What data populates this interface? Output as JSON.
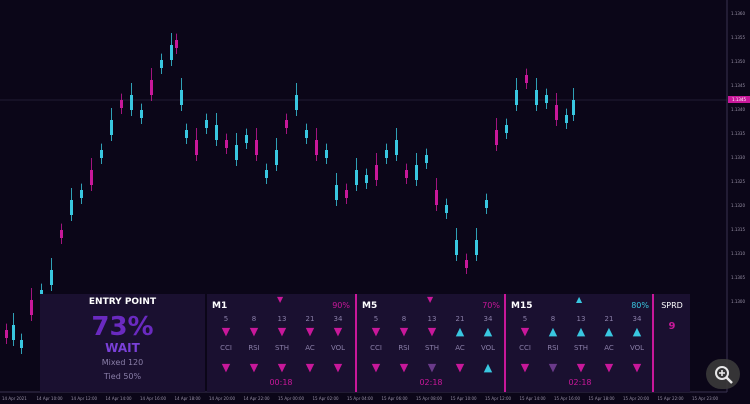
{
  "chart": {
    "symbol": "",
    "price_tag": "1.1345",
    "y_ticks": [
      "1.1360",
      "1.1355",
      "1.1350",
      "1.1345",
      "1.1340",
      "1.1335",
      "1.1330",
      "1.1325",
      "1.1320",
      "1.1315",
      "1.1310",
      "1.1305",
      "1.1300"
    ],
    "x_ticks": [
      "14 Apr 2021",
      "14 Apr 10:00",
      "14 Apr 12:00",
      "14 Apr 14:00",
      "14 Apr 16:00",
      "14 Apr 18:00",
      "14 Apr 20:00",
      "14 Apr 22:00",
      "15 Apr 00:00",
      "15 Apr 02:00",
      "15 Apr 04:00",
      "15 Apr 06:00",
      "15 Apr 08:00",
      "15 Apr 10:00",
      "15 Apr 12:00",
      "15 Apr 14:00",
      "15 Apr 16:00",
      "15 Apr 18:00",
      "15 Apr 20:00",
      "15 Apr 22:00",
      "15 Apr 23:00"
    ],
    "colors": {
      "bull": "#39c7e0",
      "bear": "#c8189a",
      "bg": "#0b0618",
      "panel": "#1a1030"
    }
  },
  "entry_point": {
    "title": "ENTRY POINT",
    "percent": "73%",
    "status": "WAIT",
    "mixed": "Mixed 120",
    "tied": "Tied 50%"
  },
  "timeframes": [
    {
      "name": "M1",
      "percent": "90%",
      "top_arrow": "▼",
      "top_dir": "dn",
      "periods": [
        "5",
        "8",
        "13",
        "21",
        "34"
      ],
      "row1": [
        {
          "g": "▼",
          "d": "dn"
        },
        {
          "g": "▼",
          "d": "dn"
        },
        {
          "g": "▼",
          "d": "dn"
        },
        {
          "g": "▼",
          "d": "dn"
        },
        {
          "g": "▼",
          "d": "dn"
        }
      ],
      "indicators": [
        "CCI",
        "RSI",
        "STH",
        "AC",
        "VOL"
      ],
      "row2": [
        {
          "g": "▼",
          "d": "dn"
        },
        {
          "g": "▼",
          "d": "dn"
        },
        {
          "g": "▼",
          "d": "dn"
        },
        {
          "g": "▼",
          "d": "dn"
        },
        {
          "g": "▼",
          "d": "dn"
        }
      ],
      "timer": "00:18"
    },
    {
      "name": "M5",
      "percent": "70%",
      "top_arrow": "▼",
      "top_dir": "dn",
      "periods": [
        "5",
        "8",
        "13",
        "21",
        "34"
      ],
      "row1": [
        {
          "g": "▼",
          "d": "dn"
        },
        {
          "g": "▼",
          "d": "dn"
        },
        {
          "g": "▼",
          "d": "dn"
        },
        {
          "g": "▲",
          "d": "up"
        },
        {
          "g": "▲",
          "d": "up"
        }
      ],
      "indicators": [
        "CCI",
        "RSI",
        "STH",
        "AC",
        "VOL"
      ],
      "row2": [
        {
          "g": "▼",
          "d": "dn"
        },
        {
          "g": "▼",
          "d": "dn"
        },
        {
          "g": "▼",
          "d": "ne"
        },
        {
          "g": "▼",
          "d": "dn"
        },
        {
          "g": "▲",
          "d": "up"
        }
      ],
      "timer": "02:18"
    },
    {
      "name": "M15",
      "percent": "80%",
      "top_arrow": "▲",
      "top_dir": "up",
      "periods": [
        "5",
        "8",
        "13",
        "21",
        "34"
      ],
      "row1": [
        {
          "g": "▼",
          "d": "dn"
        },
        {
          "g": "▲",
          "d": "up"
        },
        {
          "g": "▲",
          "d": "up"
        },
        {
          "g": "▲",
          "d": "up"
        },
        {
          "g": "▲",
          "d": "up"
        }
      ],
      "indicators": [
        "CCI",
        "RSI",
        "STH",
        "AC",
        "VOL"
      ],
      "row2": [
        {
          "g": "▼",
          "d": "dn"
        },
        {
          "g": "▼",
          "d": "ne"
        },
        {
          "g": "▼",
          "d": "dn"
        },
        {
          "g": "▼",
          "d": "dn"
        },
        {
          "g": "▼",
          "d": "dn"
        }
      ],
      "timer": "02:18"
    }
  ],
  "spread": {
    "label": "SPRD",
    "value": "9"
  },
  "icons": {
    "zoom": "zoom-in-icon"
  }
}
